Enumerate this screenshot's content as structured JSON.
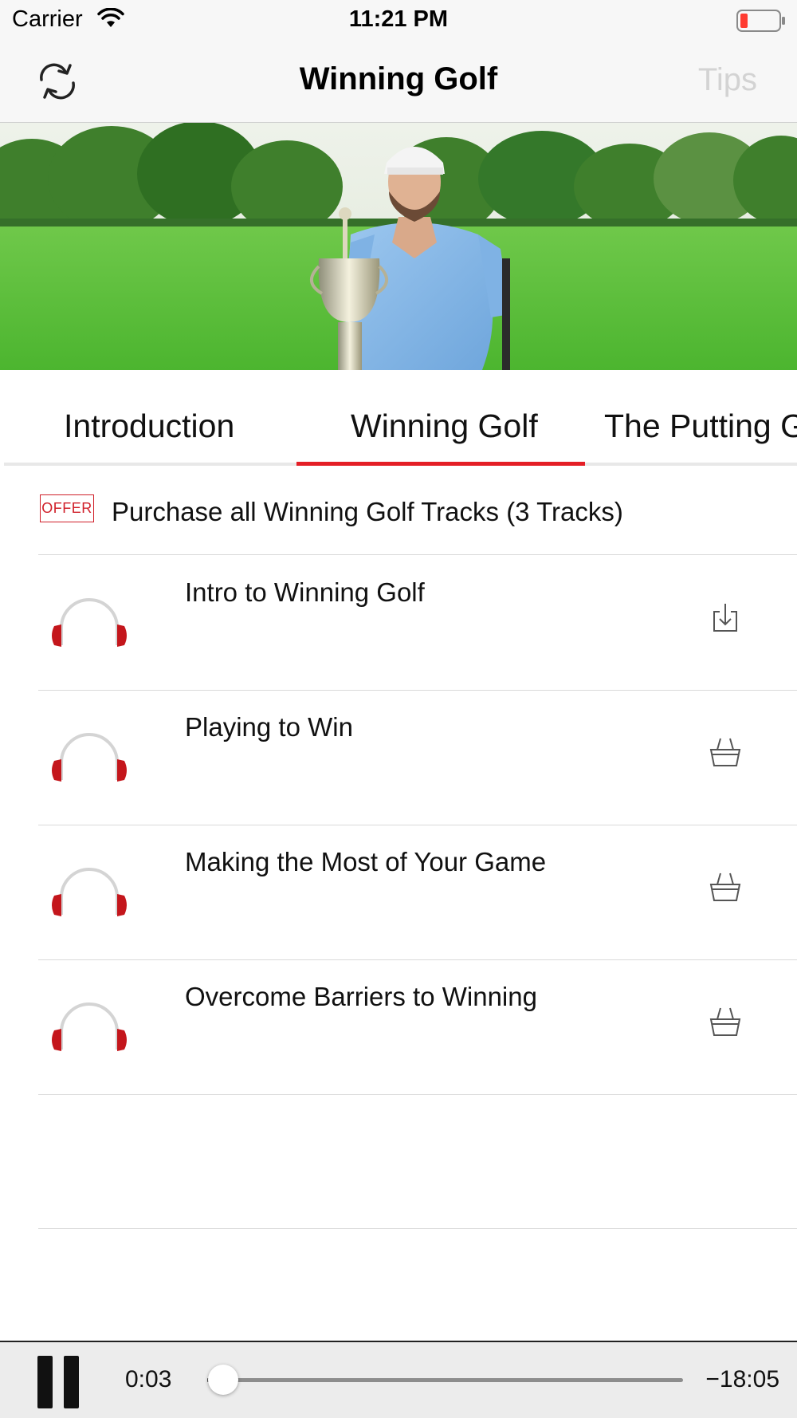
{
  "status_bar": {
    "carrier": "Carrier",
    "time": "11:21 PM",
    "battery_color": "#ff3b30"
  },
  "nav": {
    "title": "Winning Golf",
    "right_button": "Tips",
    "left_icon": "repeat-icon"
  },
  "tabs": [
    {
      "label": "Introduction",
      "selected": false
    },
    {
      "label": "Winning Golf",
      "selected": true
    },
    {
      "label": "The Putting G",
      "selected": false
    }
  ],
  "offer": {
    "badge": "OFFER",
    "text": "Purchase all Winning Golf Tracks (3 Tracks)"
  },
  "tracks": [
    {
      "title": "Intro to Winning Golf",
      "icon": "headphones-icon",
      "action": "download-icon"
    },
    {
      "title": "Playing to Win",
      "icon": "headphones-icon",
      "action": "basket-icon"
    },
    {
      "title": "Making the Most of Your Game",
      "icon": "headphones-icon",
      "action": "basket-icon"
    },
    {
      "title": "Overcome Barriers to Winning",
      "icon": "headphones-icon",
      "action": "basket-icon"
    }
  ],
  "player": {
    "elapsed": "0:03",
    "remaining": "−18:05",
    "progress": 0.003
  },
  "colors": {
    "accent": "#e41e26",
    "headphone_red": "#c4161c"
  }
}
